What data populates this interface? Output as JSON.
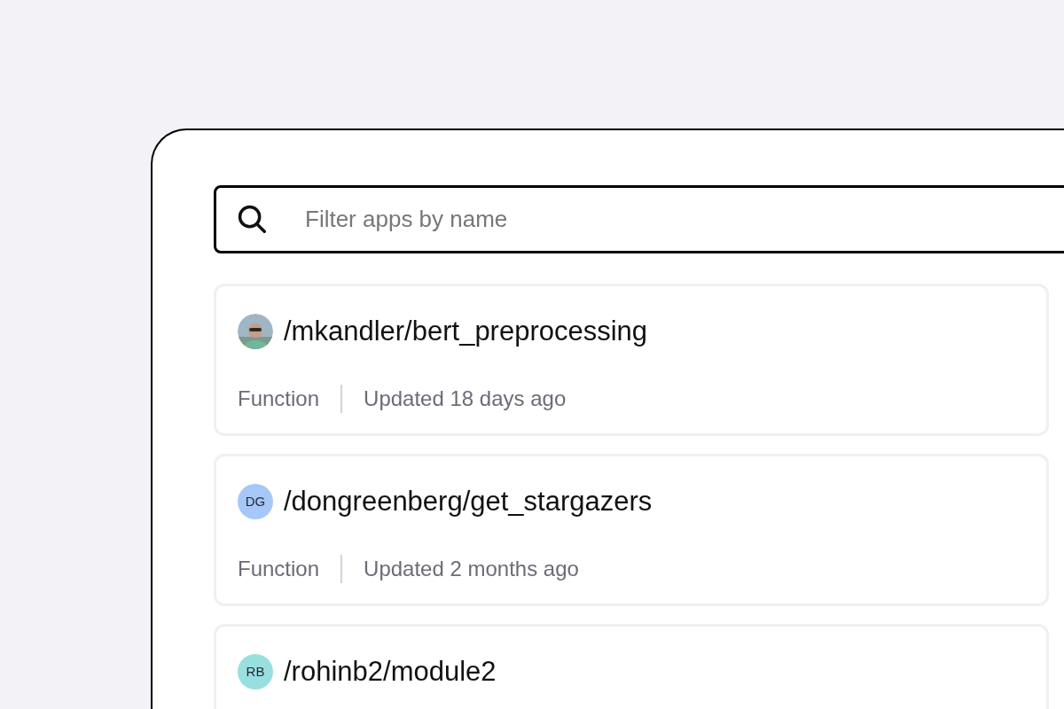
{
  "search": {
    "placeholder": "Filter apps by name"
  },
  "apps": [
    {
      "name": "/mkandler/bert_preprocessing",
      "type": "Function",
      "updated": "Updated 18 days ago"
    },
    {
      "avatar": {
        "kind": "initials",
        "initials": "DG",
        "color": "#a6c8f8"
      },
      "name": "/dongreenberg/get_stargazers",
      "type": "Function",
      "updated": "Updated 2 months ago"
    },
    {
      "avatar": {
        "kind": "initials",
        "initials": "RB",
        "color": "#9adfe0"
      },
      "name": "/rohinb2/module2"
    }
  ]
}
